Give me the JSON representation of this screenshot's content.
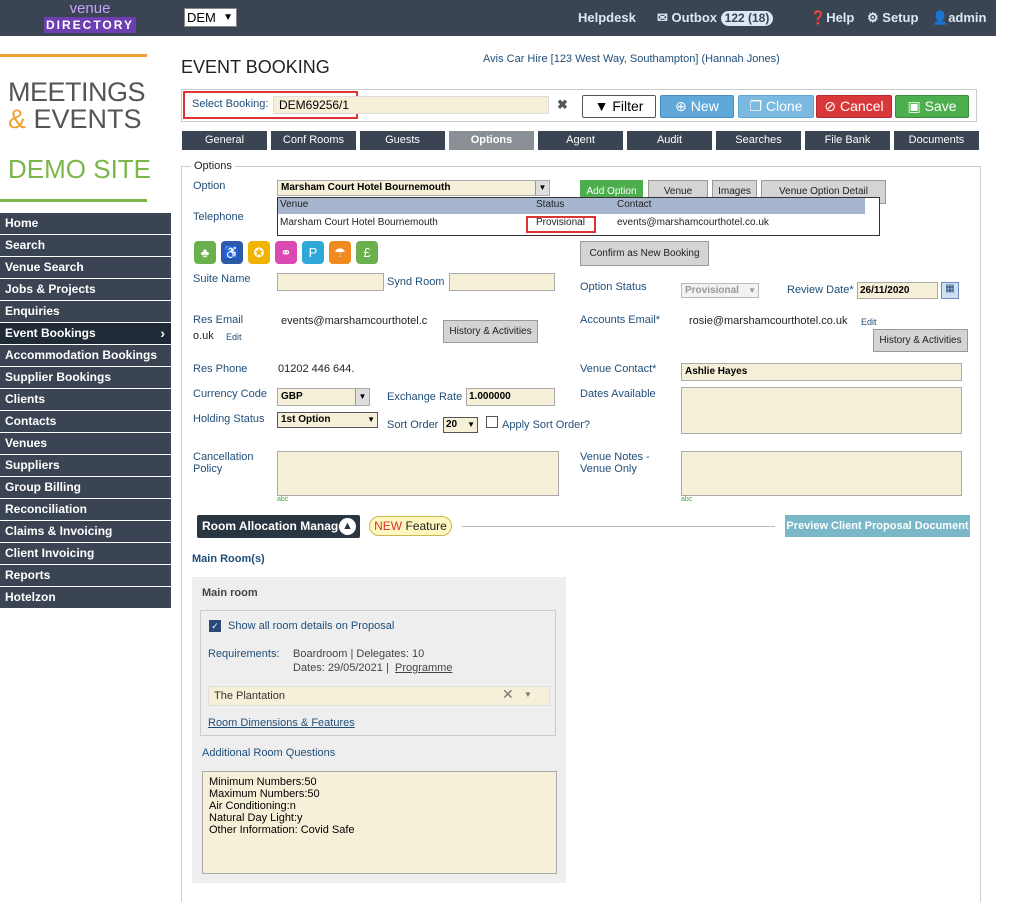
{
  "topbar": {
    "logo_line1": "venue",
    "logo_line2": "DIRECTORY",
    "account_select": "DEM",
    "helpdesk": "Helpdesk",
    "outbox": "Outbox",
    "outbox_badge": "122 (18)",
    "help": "Help",
    "setup": "Setup",
    "admin": "admin"
  },
  "brand": {
    "line1": "MEETINGS",
    "amp": "&",
    "line2": "EVENTS",
    "line3": "DEMO SITE"
  },
  "sidebar": {
    "items": [
      {
        "label": "Home"
      },
      {
        "label": "Search"
      },
      {
        "label": "Venue Search"
      },
      {
        "label": "Jobs & Projects"
      },
      {
        "label": "Enquiries"
      },
      {
        "label": "Event Bookings"
      },
      {
        "label": "Accommodation Bookings"
      },
      {
        "label": "Supplier Bookings"
      },
      {
        "label": "Clients"
      },
      {
        "label": "Contacts"
      },
      {
        "label": "Venues"
      },
      {
        "label": "Suppliers"
      },
      {
        "label": "Group Billing"
      },
      {
        "label": "Reconciliation"
      },
      {
        "label": "Claims & Invoicing"
      },
      {
        "label": "Client Invoicing"
      },
      {
        "label": "Reports"
      },
      {
        "label": "Hotelzon"
      }
    ],
    "active_index": 5
  },
  "header": {
    "title": "EVENT BOOKING",
    "client_line": "Avis Car Hire [123 West Way, Southampton] (Hannah Jones)"
  },
  "select_booking": {
    "label": "Select Booking:",
    "value": "DEM69256/1",
    "clear": "✖"
  },
  "actions": {
    "filter": "Filter",
    "new": "New",
    "clone": "Clone",
    "cancel": "Cancel",
    "save": "Save"
  },
  "tabs": [
    {
      "label": "General"
    },
    {
      "label": "Conf Rooms"
    },
    {
      "label": "Guests"
    },
    {
      "label": "Options"
    },
    {
      "label": "Agent"
    },
    {
      "label": "Audit"
    },
    {
      "label": "Searches"
    },
    {
      "label": "File Bank"
    },
    {
      "label": "Documents"
    }
  ],
  "options": {
    "legend": "Options",
    "option_label": "Option",
    "option_value": "Marsham Court Hotel Bournemouth",
    "add_option": "Add Option",
    "venue_btn": "Venue",
    "images_btn": "Images",
    "venue_option_detail": "Venue Option Detail",
    "dropdown": {
      "headers": {
        "venue": "Venue",
        "status": "Status",
        "contact": "Contact"
      },
      "row": {
        "venue": "Marsham Court Hotel Bournemouth",
        "status": "Provisional",
        "contact": "events@marshamcourthotel.co.uk"
      }
    },
    "telephone_label": "Telephone",
    "confirm_new_booking": "Confirm as New Booking",
    "suite_name_label": "Suite Name",
    "synd_room_label": "Synd Room",
    "option_status_label": "Option Status",
    "option_status_value": "Provisional",
    "review_date_label": "Review Date*",
    "review_date_value": "26/11/2020",
    "res_email_label": "Res Email",
    "res_email_value": "events@marshamcourthotel.c",
    "res_email_value2": "o.uk",
    "edit": "Edit",
    "history_activities": "History & Activities",
    "accounts_email_label": "Accounts Email*",
    "accounts_email_value": "rosie@marshamcourthotel.co.uk",
    "res_phone_label": "Res Phone",
    "res_phone_value": "01202 446 644.",
    "venue_contact_label": "Venue Contact*",
    "venue_contact_value": "Ashlie Hayes",
    "currency_label": "Currency Code",
    "currency_value": "GBP",
    "exchange_label": "Exchange Rate",
    "exchange_value": "1.000000",
    "dates_available_label": "Dates Available",
    "holding_label": "Holding Status",
    "holding_value": "1st Option",
    "sort_order_label": "Sort Order",
    "sort_order_value": "20",
    "apply_sort_label": "Apply Sort Order?",
    "cancellation_label1": "Cancellation",
    "cancellation_label2": "Policy",
    "venue_notes_label1": "Venue Notes -",
    "venue_notes_label2": "Venue Only",
    "spell": "abc"
  },
  "room_allocation": {
    "button": "Room Allocation Manager",
    "new_word": "NEW",
    "feature_word": "Feature",
    "preview": "Preview Client Proposal Document"
  },
  "main_rooms": {
    "heading": "Main Room(s)",
    "panel_title": "Main room",
    "show_all_label": "Show all room details on Proposal",
    "requirements_label": "Requirements:",
    "requirements_line1": "Boardroom | Delegates: 10",
    "requirements_dates": "Dates: 29/05/2021 |",
    "programme_link": "Programme",
    "room_value": "The Plantation",
    "dimensions_link": "Room Dimensions & Features",
    "additional_questions": "Additional Room Questions",
    "additional_text": "Minimum Numbers:50\nMaximum Numbers:50\nAir Conditioning:n\nNatural Day Light:y\nOther Information: Covid Safe"
  }
}
